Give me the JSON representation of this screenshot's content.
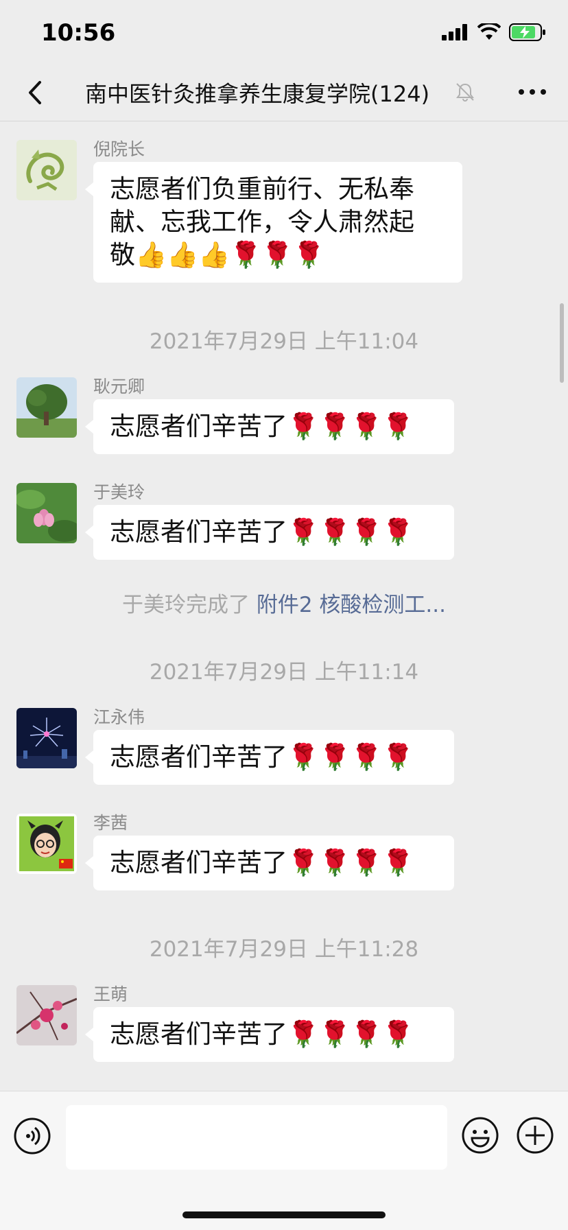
{
  "status_bar": {
    "time": "10:56"
  },
  "nav": {
    "title": "南中医针灸推拿养生康复学院(124)"
  },
  "messages": [
    {
      "sender": "倪院长",
      "text": "志愿者们负重前行、无私奉献、忘我工作，令人肃然起敬👍👍👍🌹🌹🌹",
      "line1": "志愿者们负重前行、无私奉",
      "line2": "献、忘我工作，令人肃然起",
      "line3": "敬👍👍👍🌹🌹🌹",
      "avatar_icon": "dragon-logo"
    },
    {
      "sender": "耿元卿",
      "text": "志愿者们辛苦了🌹🌹🌹🌹",
      "avatar_icon": "tree-photo"
    },
    {
      "sender": "于美玲",
      "text": "志愿者们辛苦了🌹🌹🌹🌹",
      "avatar_icon": "lotus-photo"
    },
    {
      "sender": "江永伟",
      "text": "志愿者们辛苦了🌹🌹🌹🌹",
      "avatar_icon": "fireworks-photo"
    },
    {
      "sender": "李茜",
      "text": "志愿者们辛苦了🌹🌹🌹🌹",
      "avatar_icon": "cartoon-girl"
    },
    {
      "sender": "王萌",
      "text": "志愿者们辛苦了🌹🌹🌹🌹",
      "avatar_icon": "blossom-photo"
    }
  ],
  "timestamps": [
    "2021年7月29日 上午11:04",
    "2021年7月29日 上午11:14",
    "2021年7月29日 上午11:28"
  ],
  "system_message": {
    "prefix": "于美玲完成了",
    "link": "附件2  核酸检测工..."
  },
  "input": {
    "value": ""
  },
  "colors": {
    "background": "#ededed",
    "link": "#576b95",
    "bubble": "#ffffff"
  }
}
